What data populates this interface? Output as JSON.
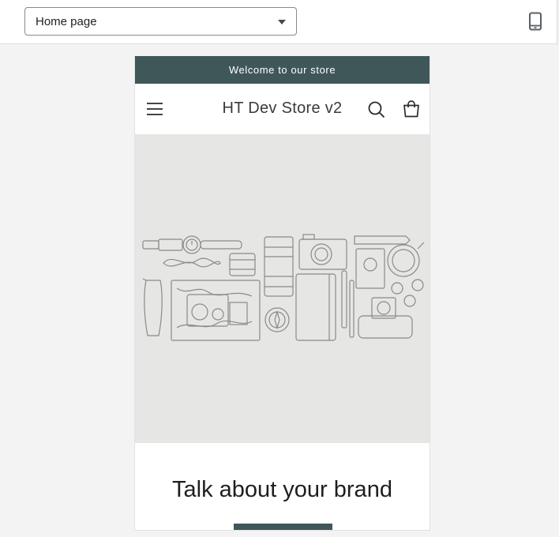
{
  "toolbar": {
    "page_select": {
      "value": "Home page"
    },
    "device_toggle_icon": "mobile-phone-icon"
  },
  "preview": {
    "announcement": "Welcome to our store",
    "header": {
      "store_name": "HT Dev Store v2",
      "menu_icon": "hamburger-menu-icon",
      "search_icon": "search-icon",
      "cart_icon": "cart-icon"
    },
    "hero": {
      "image": "flat-lay-illustration"
    },
    "brand_section": {
      "heading": "Talk about your brand"
    }
  },
  "colors": {
    "accent": "#3f5758",
    "hero_background": "#e6e6e5",
    "canvas_background": "#f3f3f3"
  }
}
